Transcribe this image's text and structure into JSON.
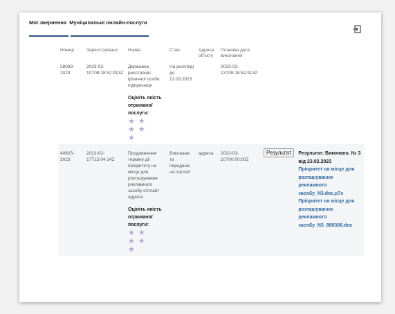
{
  "tabs": [
    "Мої звернення",
    "Муніципальні онлайн-послуги"
  ],
  "logout_icon": "logout-icon",
  "columns": [
    "Номер",
    "Зареєстровано",
    "Назва",
    "Стан",
    "Адреса об'єкту",
    "Планова дата виконання"
  ],
  "rows": [
    {
      "number": "58093-2023",
      "registered": "2023-03-10T08:18:52.913Z",
      "name": "Державна реєстрація фізичної особи підприємця",
      "status": "На розгляді до 13.03.2023",
      "address": "",
      "planned": "2023-03-13T08:18:52.913Z",
      "rate_label": "Оцініть якість отриманої послуги:",
      "stars": [
        "★ ★",
        "★ ★",
        "★"
      ]
    },
    {
      "number": "40825-2023",
      "registered": "2023-02-17T15:04:14Z",
      "name": "Продовження терміну дії пріоритету на місце для розташування рекламного засобу сітілайт адреса",
      "status": "Виконана та передана на портал",
      "address": "адреса",
      "planned": "2023-03-10T00:00:00Z",
      "result_button": "Результат",
      "result_text": "Результат: Виконано. № 3 від 23.02.2023",
      "files": [
        "Пріоритет на місце для розташування рекламного засобу_N3.doc.p7s",
        "Пріоритет на місце для розташування рекламного засобу_N3_889306.doc"
      ],
      "rate_label": "Оцініть якість отриманої послуги:",
      "stars": [
        "★ ★",
        "★ ★",
        "★"
      ]
    }
  ]
}
